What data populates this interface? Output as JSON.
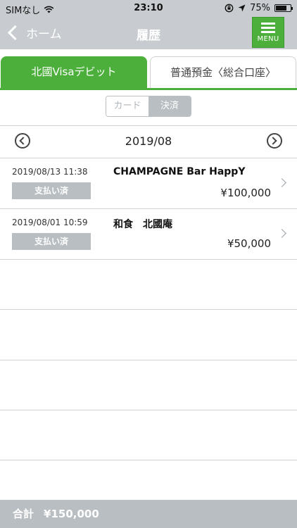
{
  "status_bar": {
    "carrier": "SIMなし",
    "time": "23:10",
    "battery_percent_label": "75%",
    "battery_level": 0.75
  },
  "nav": {
    "back_label": "ホーム",
    "title": "履歴",
    "menu_label": "MENU"
  },
  "account_tabs": [
    {
      "label": "北國Visaデビット",
      "active": true
    },
    {
      "label": "普通預金〈総合口座〉",
      "active": false
    }
  ],
  "segmented": {
    "card_label": "カード",
    "payment_label": "決済",
    "selected": "決済"
  },
  "month": "2019/08",
  "transactions": [
    {
      "datetime": "2019/08/13 11:38",
      "status": "支払い済",
      "merchant": "CHAMPAGNE Bar HappY",
      "amount": "¥100,000"
    },
    {
      "datetime": "2019/08/01 10:59",
      "status": "支払い済",
      "merchant": "和食　北國庵",
      "amount": "¥50,000"
    }
  ],
  "footer": {
    "total_label": "合計",
    "total_amount": "¥150,000"
  },
  "colors": {
    "accent_green": "#4caf3b",
    "nav_gray": "#c8ccd0",
    "badge_gray": "#b8bec2"
  }
}
